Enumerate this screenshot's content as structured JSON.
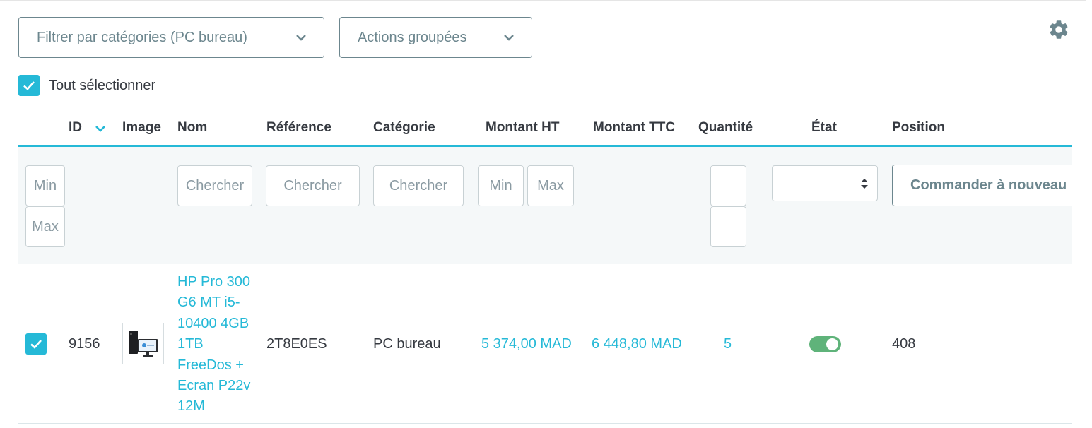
{
  "toolbar": {
    "category_filter_label": "Filtrer par catégories (PC bureau)",
    "bulk_actions_label": "Actions groupées",
    "select_all_label": "Tout sélectionner"
  },
  "table": {
    "headers": {
      "id": "ID",
      "image": "Image",
      "name": "Nom",
      "reference": "Référence",
      "category": "Catégorie",
      "price_ht": "Montant HT",
      "price_ttc": "Montant TTC",
      "quantity": "Quantité",
      "status": "État",
      "position": "Position"
    },
    "filters": {
      "id_min_placeholder": "Min",
      "id_max_placeholder": "Max",
      "name_placeholder": "Chercher",
      "reference_placeholder": "Chercher",
      "category_placeholder": "Chercher",
      "price_min_placeholder": "Min",
      "price_max_placeholder": "Max",
      "quantity_min_placeholder": "",
      "quantity_max_placeholder": "",
      "status_value": "",
      "reorder_label": "Commander à nouveau"
    },
    "rows": [
      {
        "checked": true,
        "id": "9156",
        "name": "HP Pro 300\nG6 MT i5-\n10400 4GB\n1TB\nFreeDos +\nEcran P22v\n12M",
        "reference": "2T8E0ES",
        "category": "PC bureau",
        "price_ht": "5 374,00 MAD",
        "price_ttc": "6 448,80 MAD",
        "quantity": "5",
        "status_enabled": true,
        "position": "408"
      }
    ]
  },
  "colors": {
    "accent": "#25b9d7",
    "toggle_on": "#5fb37a",
    "muted": "#6c868e"
  }
}
